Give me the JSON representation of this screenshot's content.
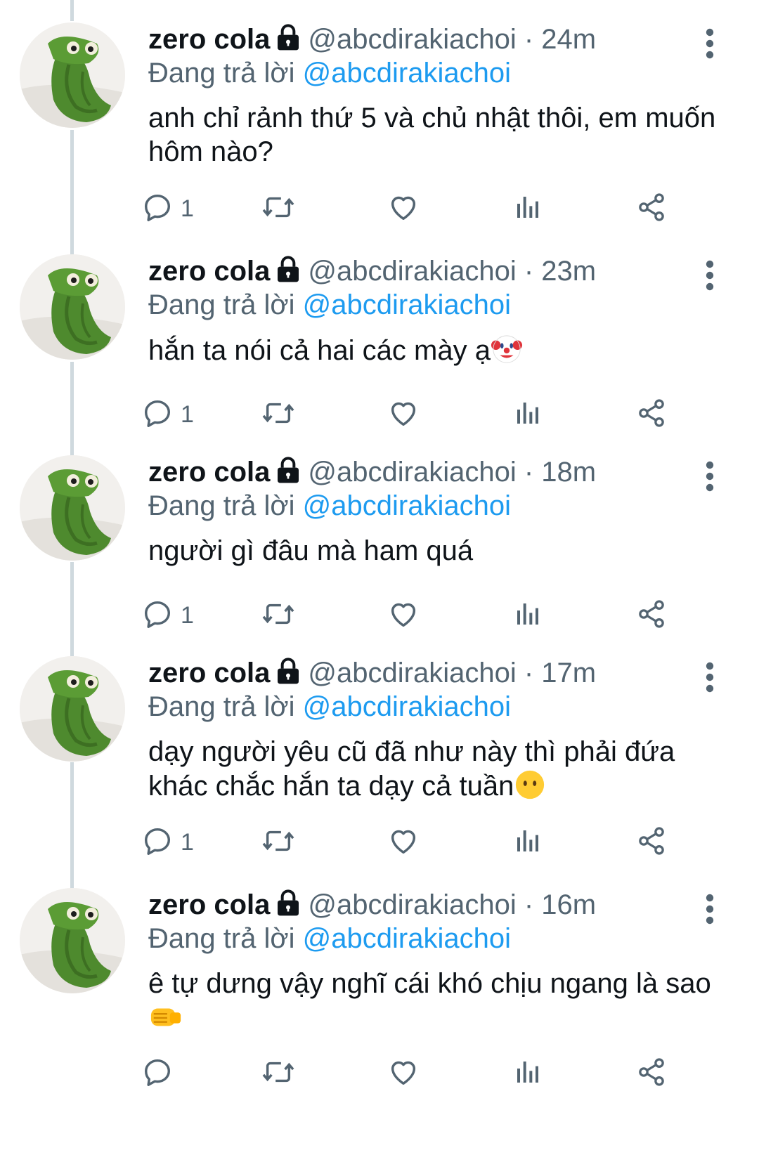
{
  "tweets": [
    {
      "name": "zero cola",
      "handle": "@abcdirakiachoi",
      "dot": "·",
      "time": "24m",
      "replying_prefix": "Đang trả lời",
      "replying_to": "@abcdirakiachoi",
      "text": "anh chỉ rảnh thứ 5 và chủ nhật thôi, em muốn hôm nào?",
      "emoji": "",
      "reply_count": "1"
    },
    {
      "name": "zero cola",
      "handle": "@abcdirakiachoi",
      "dot": "·",
      "time": "23m",
      "replying_prefix": "Đang trả lời",
      "replying_to": "@abcdirakiachoi",
      "text": "hắn ta nói cả hai các mày ạ",
      "emoji": "clown-face",
      "reply_count": "1"
    },
    {
      "name": "zero cola",
      "handle": "@abcdirakiachoi",
      "dot": "·",
      "time": "18m",
      "replying_prefix": "Đang trả lời",
      "replying_to": "@abcdirakiachoi",
      "text": "người gì đâu mà ham quá",
      "emoji": "",
      "reply_count": "1"
    },
    {
      "name": "zero cola",
      "handle": "@abcdirakiachoi",
      "dot": "·",
      "time": "17m",
      "replying_prefix": "Đang trả lời",
      "replying_to": "@abcdirakiachoi",
      "text": "dạy người yêu cũ đã như này thì phải đứa khác chắc hắn ta dạy cả tuần",
      "emoji": "face-without-mouth",
      "reply_count": "1"
    },
    {
      "name": "zero cola",
      "handle": "@abcdirakiachoi",
      "dot": "·",
      "time": "16m",
      "replying_prefix": "Đang trả lời",
      "replying_to": "@abcdirakiachoi",
      "text": "ê tự dưng vậy nghĩ cái khó chịu ngang là sao",
      "emoji": "left-facing-fist",
      "reply_count": ""
    }
  ],
  "colors": {
    "accent": "#1d9bf0",
    "secondary_text": "#536471",
    "thread_line": "#cfd9de",
    "avatar_frog_green": "#4e8a2e"
  },
  "icons": [
    "lock-icon",
    "more-icon",
    "reply-icon",
    "retweet-icon",
    "like-icon",
    "analytics-icon",
    "share-icon"
  ]
}
